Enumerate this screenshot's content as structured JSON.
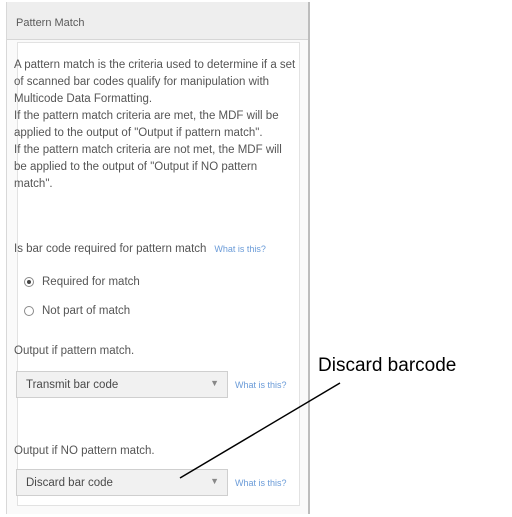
{
  "panel": {
    "title": "Pattern Match",
    "description": [
      "A pattern match is the criteria used to determine if a set of scanned bar codes qualify for manipulation with Multicode Data Formatting.",
      "If the pattern match criteria are met, the MDF will be applied to the output of \"Output if pattern match\".",
      "If the pattern match criteria are not met, the MDF will be applied to the output of \"Output if NO pattern match\"."
    ],
    "required_question": "Is bar code required for pattern match",
    "help_link": "What is this?",
    "radio_options": [
      {
        "label": "Required for match",
        "selected": true
      },
      {
        "label": "Not part of match",
        "selected": false
      }
    ],
    "output_if_match": {
      "label": "Output if pattern match.",
      "value": "Transmit bar code",
      "help_link": "What is this?"
    },
    "output_if_no_match": {
      "label": "Output if NO pattern match.",
      "value": "Discard bar code",
      "help_link": "What is this?"
    }
  },
  "callout": {
    "label": "Discard barcode"
  },
  "colors": {
    "link": "#6a9bd8",
    "text": "#555555",
    "select_bg": "#f1f1f1"
  },
  "icons": {
    "dropdown": "chevron-down-icon",
    "radio_on": "radio-checked-icon",
    "radio_off": "radio-unchecked-icon"
  }
}
